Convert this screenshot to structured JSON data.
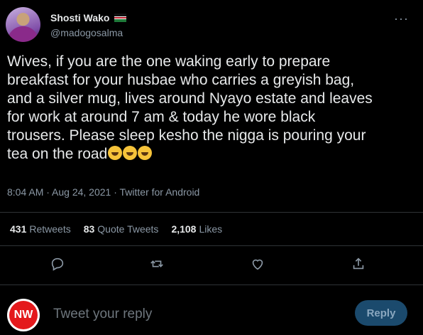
{
  "tweet": {
    "author": {
      "display_name": "Shosti Wako",
      "handle": "@madogosalma",
      "flag_icon": "kenya-flag-icon"
    },
    "text_lines": [
      "Wives, if you are the one waking early to prepare",
      "breakfast for your husbae who carries a greyish bag,",
      "and a silver mug, lives around Nyayo estate and leaves",
      "for work at around 7 am & today he wore black",
      "trousers. Please sleep kesho the nigga is pouring your",
      "tea on the road"
    ],
    "emojis": [
      "rolling-on-the-floor-laughing",
      "rolling-on-the-floor-laughing",
      "rolling-on-the-floor-laughing"
    ],
    "meta": "8:04 AM · Aug 24, 2021 · Twitter for Android"
  },
  "stats": {
    "retweets": {
      "count": "431",
      "label": "Retweets"
    },
    "quote_tweets": {
      "count": "83",
      "label": "Quote Tweets"
    },
    "likes": {
      "count": "2,108",
      "label": "Likes"
    }
  },
  "actions": {
    "icons": [
      "reply-icon",
      "retweet-icon",
      "like-icon",
      "share-icon"
    ]
  },
  "reply": {
    "avatar_text": "NW",
    "placeholder": "Tweet your reply",
    "button_label": "Reply"
  },
  "colors": {
    "background": "#000000",
    "text": "#e7e9ea",
    "muted": "#8b98a5",
    "reply_button": "#1b4a6d",
    "avatar_badge": "#e4191c"
  }
}
